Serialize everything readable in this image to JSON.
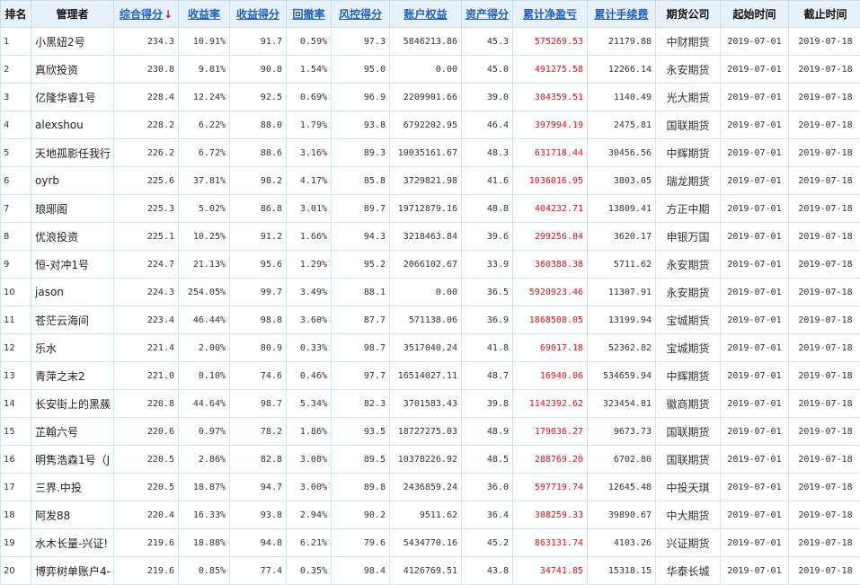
{
  "headers": [
    {
      "label": "排名",
      "sortable": false
    },
    {
      "label": "管理者",
      "sortable": false
    },
    {
      "label": "综合得分",
      "sortable": true,
      "arrow": "↓"
    },
    {
      "label": "收益率",
      "sortable": true
    },
    {
      "label": "收益得分",
      "sortable": true
    },
    {
      "label": "回撤率",
      "sortable": true
    },
    {
      "label": "风控得分",
      "sortable": true
    },
    {
      "label": "账户权益",
      "sortable": true
    },
    {
      "label": "资产得分",
      "sortable": true
    },
    {
      "label": "累计净盈亏",
      "sortable": true
    },
    {
      "label": "累计手续费",
      "sortable": true
    },
    {
      "label": "期货公司",
      "sortable": false
    },
    {
      "label": "起始时间",
      "sortable": false
    },
    {
      "label": "截止时间",
      "sortable": false
    }
  ],
  "rows": [
    [
      "1",
      "小黑妞2号",
      "234.3",
      "10.91%",
      "91.7",
      "0.59%",
      "97.3",
      "5846213.86",
      "45.3",
      "575269.53",
      "21179.88",
      "中财期货",
      "2019-07-01",
      "2019-07-18"
    ],
    [
      "2",
      "真欣投资",
      "230.8",
      "9.81%",
      "90.8",
      "1.54%",
      "95.0",
      "0.00",
      "45.0",
      "491275.58",
      "12266.14",
      "永安期货",
      "2019-07-01",
      "2019-07-18"
    ],
    [
      "3",
      "亿隆华睿1号",
      "228.4",
      "12.24%",
      "92.5",
      "0.69%",
      "96.9",
      "2209901.66",
      "39.0",
      "304359.51",
      "1140.49",
      "光大期货",
      "2019-07-01",
      "2019-07-18"
    ],
    [
      "4",
      "alexshou",
      "228.2",
      "6.22%",
      "88.0",
      "1.79%",
      "93.8",
      "6792202.95",
      "46.4",
      "397994.19",
      "2475.81",
      "国联期货",
      "2019-07-01",
      "2019-07-18"
    ],
    [
      "5",
      "天地孤影任我行",
      "226.2",
      "6.72%",
      "88.6",
      "3.16%",
      "89.3",
      "10035161.67",
      "48.3",
      "631718.44",
      "30456.56",
      "中辉期货",
      "2019-07-01",
      "2019-07-18"
    ],
    [
      "6",
      "oyrb",
      "225.6",
      "37.81%",
      "98.2",
      "4.17%",
      "85.8",
      "3729821.98",
      "41.6",
      "1036016.95",
      "3803.05",
      "瑞龙期货",
      "2019-07-01",
      "2019-07-18"
    ],
    [
      "7",
      "琅琊阁",
      "225.3",
      "5.02%",
      "86.8",
      "3.01%",
      "89.7",
      "19712879.16",
      "48.8",
      "404232.71",
      "13809.41",
      "方正中期",
      "2019-07-01",
      "2019-07-18"
    ],
    [
      "8",
      "优浪投资",
      "225.1",
      "10.25%",
      "91.2",
      "1.66%",
      "94.3",
      "3218463.84",
      "39.6",
      "299256.04",
      "3620.17",
      "申银万国",
      "2019-07-01",
      "2019-07-18"
    ],
    [
      "9",
      "恒-对冲1号",
      "224.7",
      "21.13%",
      "95.6",
      "1.29%",
      "95.2",
      "2066102.67",
      "33.9",
      "360388.38",
      "5711.62",
      "永安期货",
      "2019-07-01",
      "2019-07-18"
    ],
    [
      "10",
      "jason",
      "224.3",
      "254.05%",
      "99.7",
      "3.49%",
      "88.1",
      "0.00",
      "36.5",
      "5920923.46",
      "11307.91",
      "永安期货",
      "2019-07-01",
      "2019-07-18"
    ],
    [
      "11",
      "苍茫云海间",
      "223.4",
      "46.44%",
      "98.8",
      "3.60%",
      "87.7",
      "571138.06",
      "36.9",
      "1868508.05",
      "13199.94",
      "宝城期货",
      "2019-07-01",
      "2019-07-18"
    ],
    [
      "12",
      "乐水",
      "221.4",
      "2.00%",
      "80.9",
      "0.33%",
      "98.7",
      "3517040.24",
      "41.8",
      "69017.18",
      "52362.82",
      "宝城期货",
      "2019-07-01",
      "2019-07-18"
    ],
    [
      "13",
      "青萍之末2",
      "221.0",
      "0.10%",
      "74.6",
      "0.46%",
      "97.7",
      "16514027.11",
      "48.7",
      "16940.06",
      "534659.94",
      "中辉期货",
      "2019-07-01",
      "2019-07-18"
    ],
    [
      "14",
      "长安街上的黑蔟",
      "220.8",
      "44.64%",
      "98.7",
      "5.34%",
      "82.3",
      "3701583.43",
      "39.8",
      "1142392.62",
      "323454.81",
      "徽商期货",
      "2019-07-01",
      "2019-07-18"
    ],
    [
      "15",
      "芷翰六号",
      "220.6",
      "0.97%",
      "78.2",
      "1.86%",
      "93.5",
      "18727275.03",
      "48.9",
      "179036.27",
      "9673.73",
      "国联期货",
      "2019-07-01",
      "2019-07-18"
    ],
    [
      "16",
      "明隽浩森1号（J",
      "220.5",
      "2.86%",
      "82.8",
      "3.08%",
      "89.5",
      "10378226.92",
      "48.5",
      "288769.20",
      "6702.80",
      "国联期货",
      "2019-07-01",
      "2019-07-18"
    ],
    [
      "17",
      "三界.中投",
      "220.5",
      "18.87%",
      "94.7",
      "3.00%",
      "89.8",
      "2436859.24",
      "36.0",
      "597719.74",
      "12645.48",
      "中投天琪",
      "2019-07-01",
      "2019-07-18"
    ],
    [
      "18",
      "阿发88",
      "220.4",
      "16.33%",
      "93.8",
      "2.94%",
      "90.2",
      "9511.62",
      "36.4",
      "308259.33",
      "39890.67",
      "中大期货",
      "2019-07-01",
      "2019-07-18"
    ],
    [
      "19",
      "水木长量-兴证!",
      "219.6",
      "18.88%",
      "94.8",
      "6.21%",
      "79.6",
      "5434770.16",
      "45.2",
      "863131.74",
      "4103.26",
      "兴证期货",
      "2019-07-01",
      "2019-07-18"
    ],
    [
      "20",
      "博弈树单账户4-",
      "219.6",
      "0.85%",
      "77.4",
      "0.35%",
      "98.4",
      "4126769.51",
      "43.8",
      "34741.85",
      "15318.15",
      "华泰长城",
      "2019-07-01",
      "2019-07-18"
    ]
  ],
  "colors": {
    "header_bg": "#e6f1fa",
    "sort_link": "#1f5fc2",
    "profit_red": "#e8101a",
    "border": "#d5e3ef"
  }
}
